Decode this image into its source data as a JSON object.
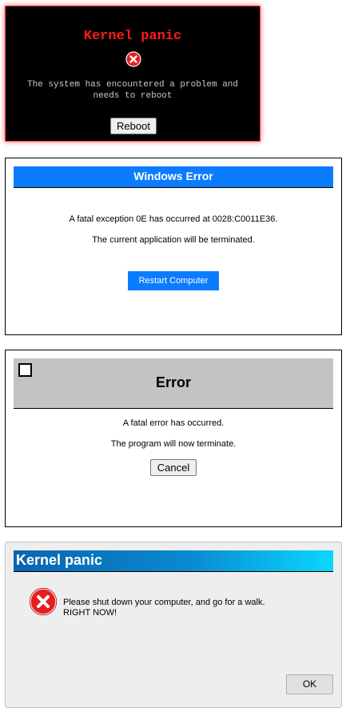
{
  "colors": {
    "kernel_panic_title": "#ff1a1a",
    "kernel_panic_bg": "#000000",
    "windows_error_accent": "#0c7cff",
    "error_titlebar": "#c3c3c3",
    "gradient_start": "#0a64b0",
    "gradient_end": "#0ad8ff",
    "error_icon_red": "#e51e1e"
  },
  "dialog_kernel_panic_terminal": {
    "title": "Kernel panic",
    "icon": "error-x-icon",
    "message": "The system has encountered a problem and needs to reboot",
    "button_label": "Reboot"
  },
  "dialog_windows_error": {
    "title": "Windows Error",
    "line1": "A fatal exception 0E has occurred at 0028:C0011E36.",
    "line2": "The current application will be terminated.",
    "button_label": "Restart Computer"
  },
  "dialog_error": {
    "title": "Error",
    "line1": "A fatal error has occurred.",
    "line2": "The program will now terminate.",
    "button_label": "Cancel"
  },
  "dialog_kernel_panic_gradient": {
    "title": "Kernel panic",
    "icon": "error-x-icon",
    "message_line1": "Please shut down your computer, and go for a walk.",
    "message_line2": "RIGHT NOW!",
    "button_label": "OK"
  }
}
